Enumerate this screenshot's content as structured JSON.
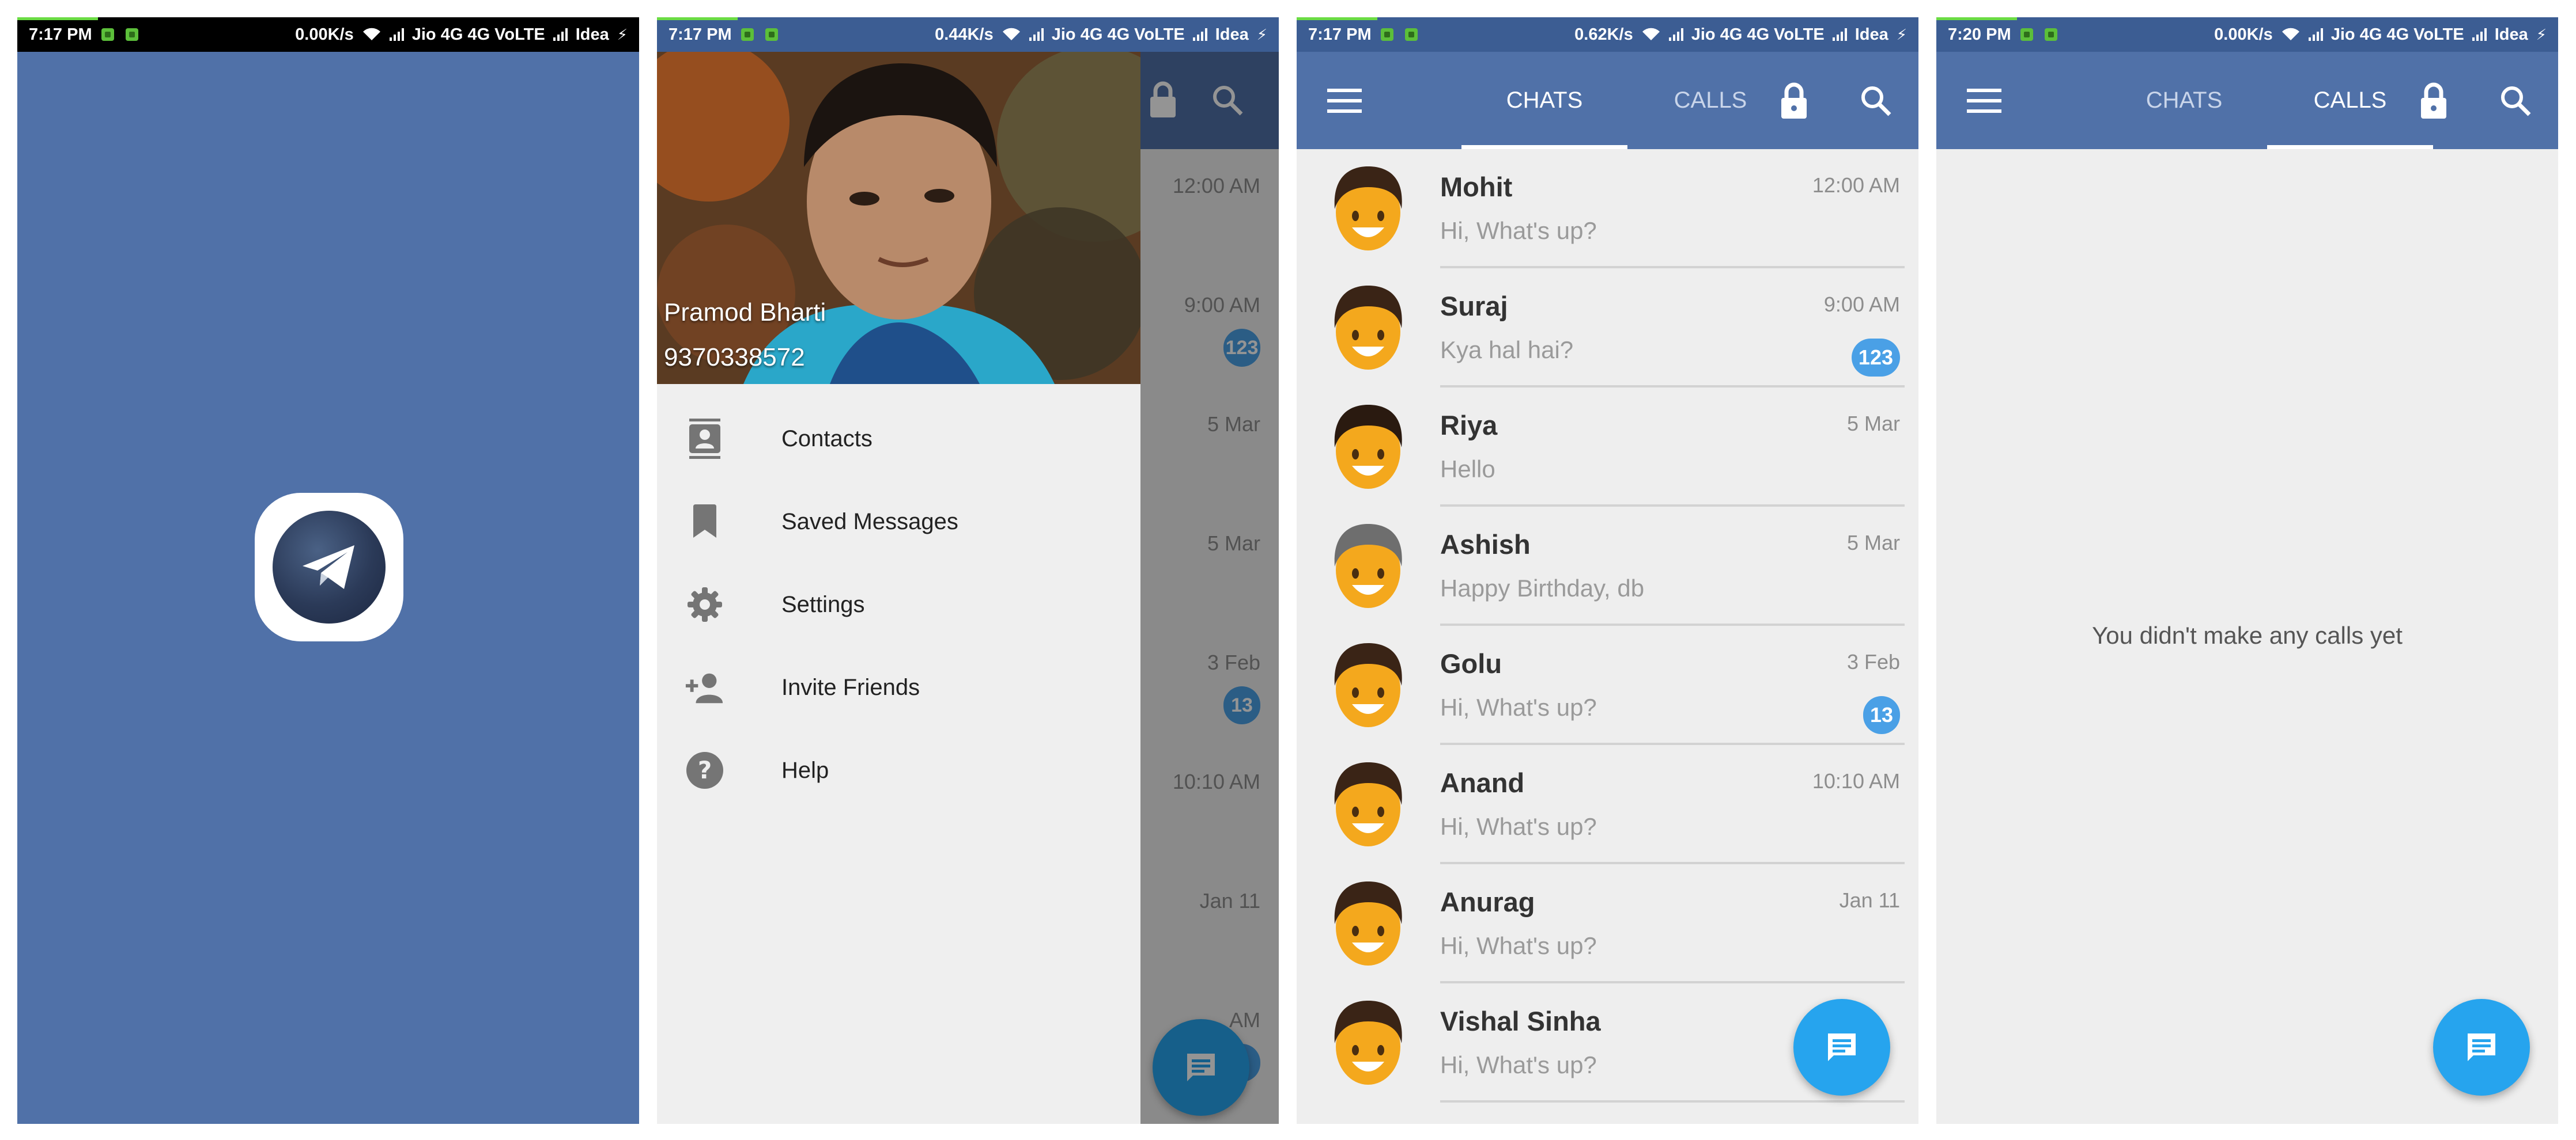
{
  "screens": {
    "splash": {
      "status": {
        "time": "7:17 PM",
        "speed": "0.00K/s",
        "carrier1": "Jio 4G 4G VoLTE",
        "carrier2": "Idea"
      }
    },
    "drawer": {
      "status": {
        "time": "7:17 PM",
        "speed": "0.44K/s",
        "carrier1": "Jio 4G 4G VoLTE",
        "carrier2": "Idea"
      },
      "profile": {
        "name": "Pramod Bharti",
        "phone": "9370338572"
      },
      "menu": [
        {
          "label": "Contacts",
          "icon": "contacts-icon"
        },
        {
          "label": "Saved Messages",
          "icon": "bookmark-icon"
        },
        {
          "label": "Settings",
          "icon": "gear-icon"
        },
        {
          "label": "Invite Friends",
          "icon": "add-person-icon"
        },
        {
          "label": "Help",
          "icon": "help-icon"
        }
      ],
      "behind_times": [
        "12:00 AM",
        "9:00 AM",
        "5 Mar",
        "5 Mar",
        "3 Feb",
        "10:10 AM",
        "Jan 11",
        "AM"
      ],
      "behind_badges": [
        "123",
        "13",
        "3"
      ]
    },
    "chats": {
      "status": {
        "time": "7:17 PM",
        "speed": "0.62K/s",
        "carrier1": "Jio 4G 4G VoLTE",
        "carrier2": "Idea"
      },
      "tabs": {
        "chats": "CHATS",
        "calls": "CALLS"
      },
      "rows": [
        {
          "name": "Mohit",
          "message": "Hi, What's up?",
          "time": "12:00 AM",
          "badge": "",
          "hair": "#3a2416"
        },
        {
          "name": "Suraj",
          "message": "Kya hal hai?",
          "time": "9:00 AM",
          "badge": "123",
          "hair": "#3a2416"
        },
        {
          "name": "Riya",
          "message": "Hello",
          "time": "5 Mar",
          "badge": "",
          "hair": "#2a1a10"
        },
        {
          "name": "Ashish",
          "message": "Happy Birthday, db",
          "time": "5 Mar",
          "badge": "",
          "hair": "#6e6e6e"
        },
        {
          "name": "Golu",
          "message": "Hi, What's up?",
          "time": "3 Feb",
          "badge": "13",
          "hair": "#3a2416"
        },
        {
          "name": "Anand",
          "message": "Hi, What's up?",
          "time": "10:10 AM",
          "badge": "",
          "hair": "#3a2416"
        },
        {
          "name": "Anurag",
          "message": "Hi, What's up?",
          "time": "Jan 11",
          "badge": "",
          "hair": "#3a2416"
        },
        {
          "name": "Vishal Sinha",
          "message": "Hi, What's up?",
          "time": "",
          "badge": "",
          "hair": "#3a2416"
        }
      ]
    },
    "calls": {
      "status": {
        "time": "7:20 PM",
        "speed": "0.00K/s",
        "carrier1": "Jio 4G 4G VoLTE",
        "carrier2": "Idea"
      },
      "tabs": {
        "chats": "CHATS",
        "calls": "CALLS"
      },
      "empty_text": "You didn't make any calls yet"
    }
  },
  "colors": {
    "primary": "#5071a8",
    "status_blue": "#3c5d93",
    "fab": "#26a4ee",
    "badge": "#4aa0e6",
    "avatar_face": "#f4a81d"
  }
}
